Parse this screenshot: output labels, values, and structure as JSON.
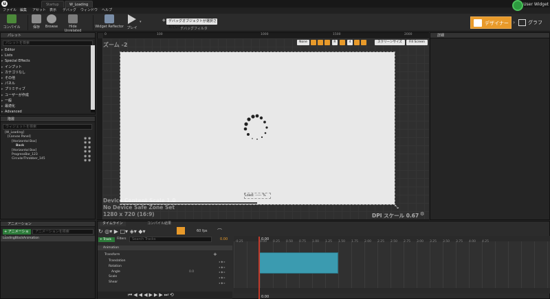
{
  "titlebar": {
    "tabs": [
      "Startup",
      "W_Loading"
    ],
    "user": "User Widget"
  },
  "menu": [
    "ファイル",
    "編集",
    "アセット",
    "表示",
    "デバッグ",
    "ウィンドウ",
    "ヘルプ"
  ],
  "toolbar": {
    "buttons": [
      "コンパイル",
      "保存",
      "Browse",
      "Hide Unrelated",
      "Widget Reflector",
      "プレイ"
    ],
    "debug_select": "デバッグオブジェクトが選択されていません",
    "debug_filter": "デバッグフィルタ"
  },
  "modes": {
    "designer": "デザイナー",
    "graph": "グラフ"
  },
  "palette": {
    "title": "パレット",
    "search": "パレットを検索",
    "items": [
      "Editor",
      "Lists",
      "Special Effects",
      "インプット",
      "カテゴリなし",
      "その他",
      "パネル",
      "プリミティブ",
      "ユーザーが作成",
      "一般",
      "最適化",
      "Advanced"
    ]
  },
  "hierarchy": {
    "title": "階層",
    "search": "ウィジェットを検索",
    "items": [
      "[W_Loading]",
      "[Canvas Panel]",
      "[Horizontal Box]",
      "Back",
      "[Horizontal Box]",
      "ProgressBar_123",
      "CircularThrobber_145"
    ]
  },
  "canvas": {
    "zoom": "ズーム -2",
    "ruler": [
      "0",
      "100",
      "1000",
      "1500",
      "2000"
    ],
    "buttons": [
      "None",
      "R",
      "4",
      "スクリーンサイズ",
      "Fill Screen"
    ],
    "overlay1": "Device Content Scale 1.0",
    "overlay2": "No Device Safe Zone Set",
    "overlay3": "1280 x 720 (16:9)",
    "dpi": "DPI スケール 0.67",
    "load": "Load: ----- %"
  },
  "details": {
    "title": "詳細"
  },
  "animations": {
    "title": "アニメーション",
    "add": "+ アニメーション",
    "search": "アニメーションを検索",
    "item": "LoadingBlackAnimation"
  },
  "timeline": {
    "tab1": "タイムライン",
    "tab2": "コンパイル結果",
    "fps": "60 fps",
    "time": "0.00",
    "track_btn": "+ Track",
    "filters": "Filters",
    "search": "Search Tracks",
    "tracks": [
      "Animation",
      "Transform",
      "Translation",
      "Rotation",
      "Angle",
      "Scale",
      "Shear"
    ],
    "angle_val": "0.0",
    "ticks": [
      "0.00",
      "0.25",
      "0.50",
      "0.75",
      "1.00",
      "1.25",
      "1.50",
      "1.75",
      "2.00",
      "2.25",
      "2.50",
      "2.75",
      "3.00",
      "3.25",
      "3.50",
      "3.75",
      "4.00",
      "4.25"
    ],
    "neg": "-0.25"
  }
}
